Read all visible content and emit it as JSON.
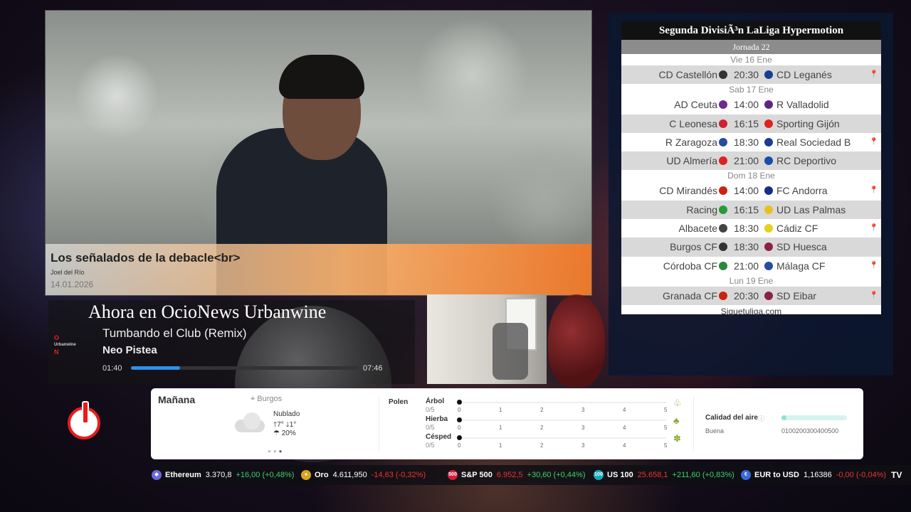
{
  "news": {
    "title": "Los señalados de la debacle<br>",
    "author": "Joel del Río",
    "date": "14.01.2026"
  },
  "league": {
    "title": "Segunda DivisiÃ³n LaLiga Hypermotion",
    "round": "Jornada 22",
    "days": [
      {
        "label": "Vie 16 Ene",
        "matches": [
          {
            "home": "CD Castellón",
            "time": "20:30",
            "away": "CD Leganés",
            "shade": true,
            "pin": true,
            "home_color": "#333",
            "away_color": "#1a3d8f"
          }
        ]
      },
      {
        "label": "Sab 17 Ene",
        "matches": [
          {
            "home": "AD Ceuta",
            "time": "14:00",
            "away": "R Valladolid",
            "shade": false,
            "pin": false,
            "home_color": "#6a2a8f",
            "away_color": "#5a2a7f"
          },
          {
            "home": "C Leonesa",
            "time": "16:15",
            "away": "Sporting Gijón",
            "shade": true,
            "pin": false,
            "home_color": "#cc2233",
            "away_color": "#d22"
          },
          {
            "home": "R Zaragoza",
            "time": "18:30",
            "away": "Real Sociedad B",
            "shade": false,
            "pin": true,
            "home_color": "#2a4aa0",
            "away_color": "#1a3d8f"
          },
          {
            "home": "UD Almería",
            "time": "21:00",
            "away": "RC Deportivo",
            "shade": true,
            "pin": false,
            "home_color": "#d22",
            "away_color": "#1a4da8"
          }
        ]
      },
      {
        "label": "Dom 18 Ene",
        "matches": [
          {
            "home": "CD Mirandés",
            "time": "14:00",
            "away": "FC Andorra",
            "shade": false,
            "pin": true,
            "home_color": "#c21",
            "away_color": "#1a2d7f"
          },
          {
            "home": "Racing",
            "time": "16:15",
            "away": "UD Las Palmas",
            "shade": true,
            "pin": false,
            "home_color": "#2a9a3a",
            "away_color": "#e5c21f"
          },
          {
            "home": "Albacete",
            "time": "18:30",
            "away": "Cádiz CF",
            "shade": false,
            "pin": true,
            "home_color": "#444",
            "away_color": "#e5d21f"
          },
          {
            "home": "Burgos CF",
            "time": "18:30",
            "away": "SD Huesca",
            "shade": true,
            "pin": false,
            "home_color": "#333",
            "away_color": "#8a2244"
          },
          {
            "home": "Córdoba CF",
            "time": "21:00",
            "away": "Málaga CF",
            "shade": false,
            "pin": true,
            "home_color": "#2a8a3a",
            "away_color": "#2a4aa0"
          }
        ]
      },
      {
        "label": "Lun 19 Ene",
        "matches": [
          {
            "home": "Granada CF",
            "time": "20:30",
            "away": "SD Eibar",
            "shade": true,
            "pin": true,
            "home_color": "#c21",
            "away_color": "#8a2244"
          }
        ]
      }
    ],
    "footer": "Siguetuliga.com"
  },
  "music": {
    "heading": "Ahora en OcioNews Urbanwine",
    "song": "Tumbando el Club (Remix)",
    "artist": "Neo Pistea",
    "current": "01:40",
    "total": "07:46",
    "progress": 0.215,
    "logo_top": "O",
    "logo_mid": "Urbanwine",
    "logo_bot": "N"
  },
  "weather": {
    "day": "Mañana",
    "location": "Burgos",
    "condition": "Nublado",
    "temps": "🡑7°  🡓1°",
    "rain": "☂ 20%",
    "pollen_label": "Polen",
    "pollen": [
      {
        "name": "Árbol",
        "value": "0/5",
        "level": 0,
        "icon": "tree-icon",
        "glyph": "♧"
      },
      {
        "name": "Hierba",
        "value": "0/5",
        "level": 0,
        "icon": "herb-icon",
        "glyph": "♣"
      },
      {
        "name": "Césped",
        "value": "0/5",
        "level": 0,
        "icon": "grass-icon",
        "glyph": "✽"
      }
    ],
    "scale": [
      "0",
      "1",
      "2",
      "3",
      "4",
      "5"
    ],
    "air_quality_label": "Calidad del aire",
    "air_quality_status": "Buena",
    "air_quality_level": 0.08,
    "air_quality_scale": "0100200300400500"
  },
  "ticker": [
    {
      "name": "Ethereum",
      "value": "3.370,8",
      "change": "+16,00 (+0,48%)",
      "dir": "up",
      "icon_color": "#6a6ad8",
      "icon_text": "◆",
      "value_color": "#fff"
    },
    {
      "name": "Oro",
      "value": "4.611,950",
      "change": "-14,63 (-0,32%)",
      "dir": "down",
      "icon_color": "#d9a521",
      "icon_text": "●",
      "value_color": "#fff"
    },
    {
      "name": "S&P 500",
      "value": "6.952,5",
      "change": "+30,60 (+0,44%)",
      "dir": "up",
      "icon_color": "#d21f3c",
      "icon_text": "500",
      "value_color": "#e33"
    },
    {
      "name": "US 100",
      "value": "25.658,1",
      "change": "+211,60 (+0,83%)",
      "dir": "up",
      "icon_color": "#18a8b8",
      "icon_text": "100",
      "value_color": "#e33"
    },
    {
      "name": "EUR to USD",
      "value": "1,16386",
      "change": "-0,00 (-0,04%)",
      "dir": "down",
      "icon_color": "#3a6ad8",
      "icon_text": "€",
      "value_color": "#fff"
    }
  ],
  "ticker_logo": "TV"
}
